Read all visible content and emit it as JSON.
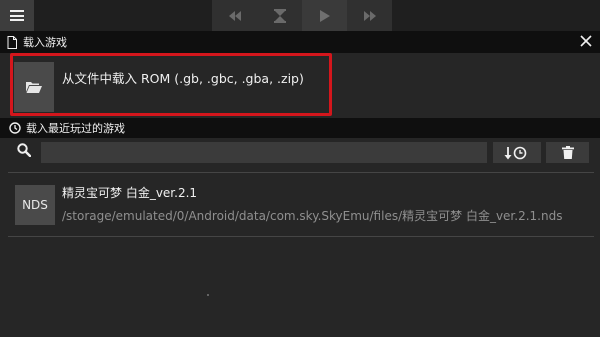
{
  "toolbar": {
    "menu_icon": "hamburger-menu-icon",
    "buttons": [
      {
        "icon": "rewind-icon"
      },
      {
        "icon": "hourglass-icon"
      },
      {
        "icon": "play-icon"
      },
      {
        "icon": "fast-forward-icon"
      }
    ]
  },
  "dialog": {
    "title": "载入游戏",
    "title_icon": "document-icon",
    "close_icon": "close-icon"
  },
  "load_file": {
    "label": "从文件中载入 ROM (.gb, .gbc, .gba, .zip)",
    "icon": "folder-open-icon",
    "highlight_color": "#d4161c"
  },
  "recent": {
    "title": "载入最近玩过的游戏",
    "icon": "clock-icon"
  },
  "search": {
    "placeholder": "",
    "value": "",
    "icon": "search-icon",
    "sort_icon": "sort-by-time-icon",
    "clear_icon": "trash-icon"
  },
  "games": [
    {
      "badge": "NDS",
      "title": "精灵宝可梦 白金_ver.2.1",
      "path": "/storage/emulated/0/Android/data/com.sky.SkyEmu/files/精灵宝可梦 白金_ver.2.1.nds"
    }
  ]
}
